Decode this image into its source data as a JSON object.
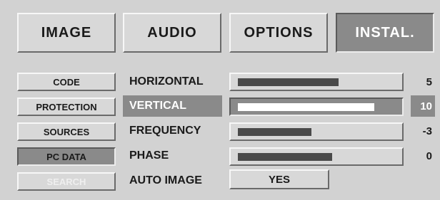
{
  "tabs": {
    "image": "IMAGE",
    "audio": "AUDIO",
    "options": "OPTIONS",
    "instal": "INSTAL."
  },
  "sidebar": {
    "code": "CODE",
    "protection": "PROTECTION",
    "sources": "SOURCES",
    "pc_data": "PC DATA",
    "search": "SEARCH"
  },
  "settings": {
    "horizontal": {
      "label": "HORIZONTAL",
      "value": "5",
      "level": 0.64
    },
    "vertical": {
      "label": "VERTICAL",
      "value": "10",
      "level": 0.87
    },
    "frequency": {
      "label": "FREQUENCY",
      "value": "-3",
      "level": 0.47
    },
    "phase": {
      "label": "PHASE",
      "value": "0",
      "level": 0.6
    },
    "auto_image": {
      "label": "AUTO IMAGE",
      "value": "YES"
    }
  }
}
